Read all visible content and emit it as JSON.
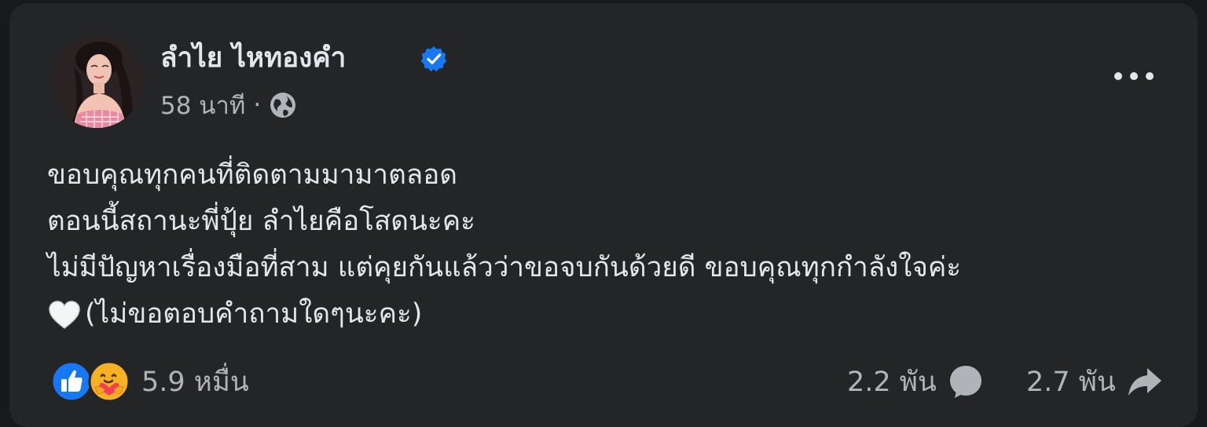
{
  "post": {
    "author": "ลำไย ไหทองคำ",
    "verified": true,
    "time": "58 นาที",
    "separator": "·",
    "privacy_icon": "globe-icon",
    "more_icon": "more-horizontal-icon",
    "text_lines": [
      "ขอบคุณทุกคนที่ติดตามมามาตลอด",
      "ตอนนี้สถานะพี่ปุ้ย ลำไยคือโสดนะคะ",
      "ไม่มีปัญหาเรื่องมือที่สาม แต่คุยกันแล้วว่าขอจบกันด้วยดี ขอบคุณทุกกำลังใจค่ะ",
      "(ไม่ขอตอบคำถามใดๆนะคะ)"
    ],
    "last_line_emoji": "white-heart-icon"
  },
  "stats": {
    "reaction_icons": [
      "like-icon",
      "care-icon"
    ],
    "reactions": "5.9 หมื่น",
    "comments": "2.2 พัน",
    "comment_icon": "comment-icon",
    "shares": "2.7 พัน",
    "share_icon": "share-icon"
  },
  "colors": {
    "page_background": "#18191a",
    "card_background": "#242526",
    "primary_text": "#e4e6eb",
    "secondary_text": "#b0b3b8",
    "verified_blue": "#1877f2",
    "like_blue": "#1877f2",
    "care_yellow": "#f7b125"
  }
}
